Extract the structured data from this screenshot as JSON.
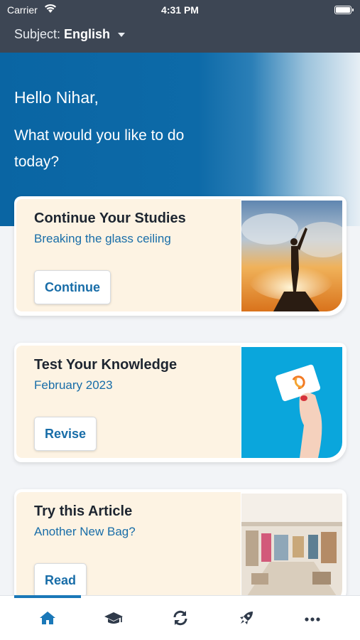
{
  "status_bar": {
    "carrier": "Carrier",
    "time": "4:31 PM"
  },
  "subject_bar": {
    "label": "Subject:",
    "value": "English"
  },
  "hero": {
    "greeting": "Hello Nihar,",
    "prompt": "What would you like to do today?"
  },
  "cards": [
    {
      "title": "Continue Your Studies",
      "subtitle": "Breaking the glass ceiling",
      "button": "Continue",
      "image": "person-on-summit-sunset"
    },
    {
      "title": "Test Your Knowledge",
      "subtitle": "February 2023",
      "button": "Revise",
      "image": "hand-holding-card"
    },
    {
      "title": "Try this Article",
      "subtitle": "Another New Bag?",
      "button": "Read",
      "image": "department-store-interior"
    }
  ],
  "tabs": [
    {
      "icon": "home-icon",
      "active": true
    },
    {
      "icon": "graduation-cap-icon",
      "active": false
    },
    {
      "icon": "refresh-icon",
      "active": false
    },
    {
      "icon": "rocket-icon",
      "active": false
    },
    {
      "icon": "more-icon",
      "active": false
    }
  ],
  "colors": {
    "accent": "#186da8",
    "active_tab": "#1a78b8",
    "inactive_tab": "#2f3a4a",
    "header": "#3d4654",
    "card_panel": "#fdf3e3"
  }
}
